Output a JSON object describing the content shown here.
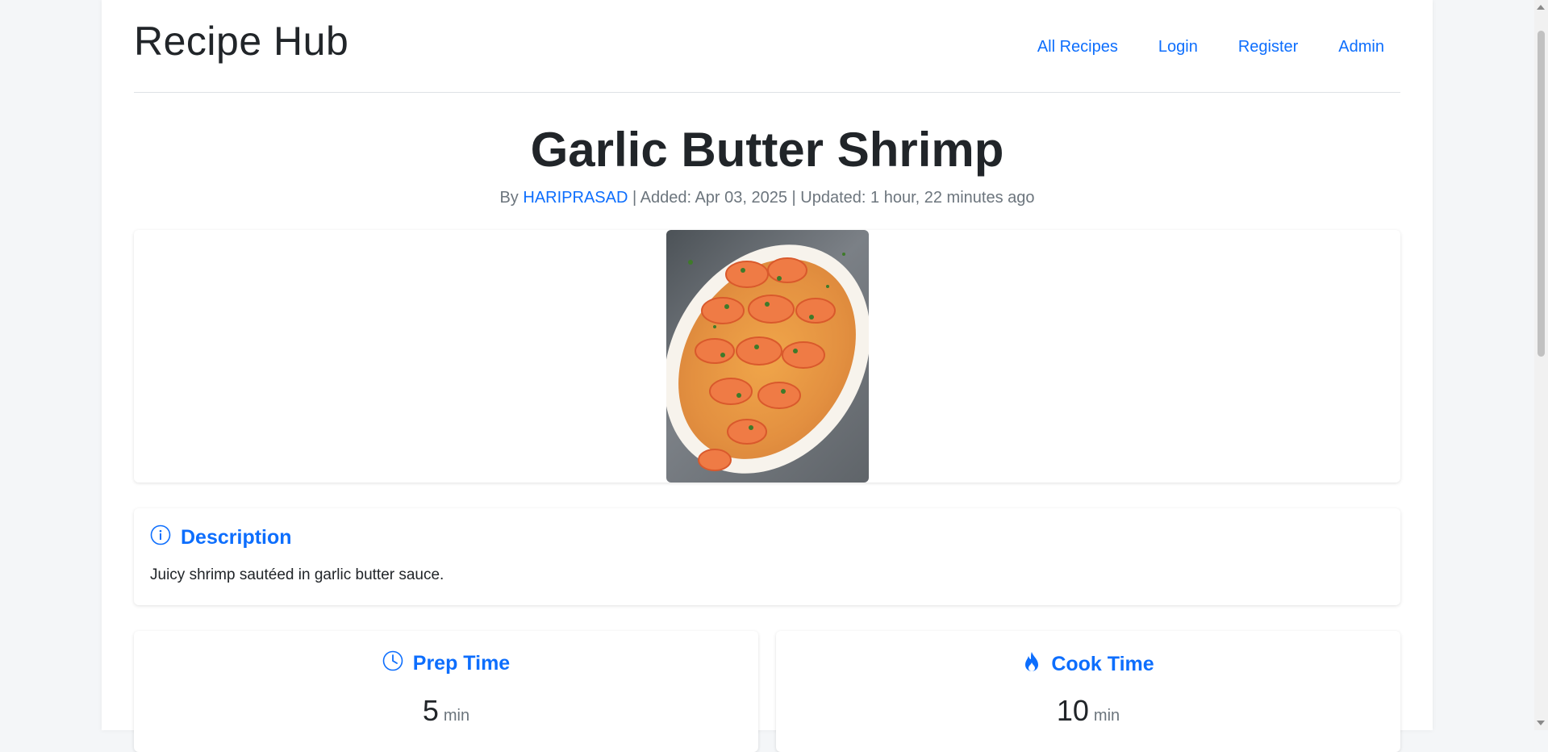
{
  "brand": "Recipe Hub",
  "nav": {
    "all_recipes": "All Recipes",
    "login": "Login",
    "register": "Register",
    "admin": "Admin"
  },
  "recipe": {
    "title": "Garlic Butter Shrimp",
    "by_prefix": "By",
    "author": "HARIPRASAD",
    "added": "| Added: Apr 03, 2025 | Updated: 1 hour, 22 minutes ago",
    "image_alt": "Garlic Butter Shrimp"
  },
  "description": {
    "heading": "Description",
    "text": "Juicy shrimp sautéed in garlic butter sauce.",
    "icon": "info-circle-icon"
  },
  "prep": {
    "heading": "Prep Time",
    "value": "5",
    "unit": "min",
    "icon": "clock-icon"
  },
  "cook": {
    "heading": "Cook Time",
    "value": "10",
    "unit": "min",
    "icon": "fire-icon"
  },
  "colors": {
    "accent": "#0d6efd",
    "text": "#212529",
    "muted": "#6c757d",
    "background": "#f4f6f8"
  }
}
